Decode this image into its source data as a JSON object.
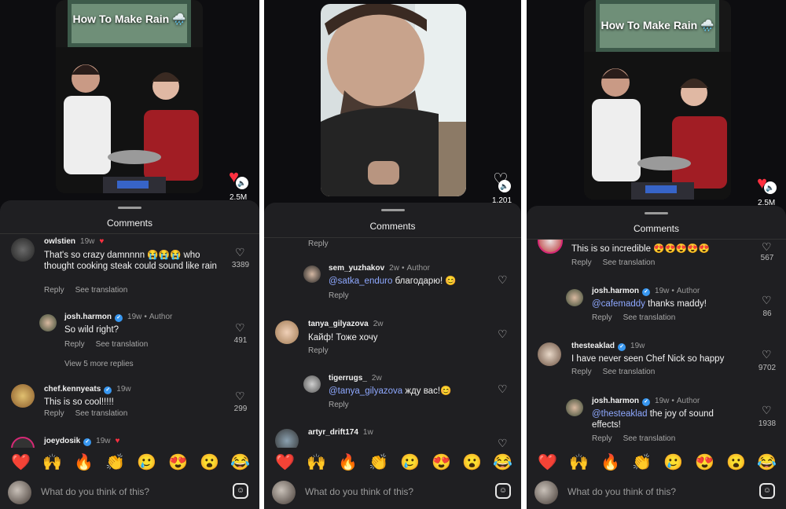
{
  "emojis": [
    "❤️",
    "🙌",
    "🔥",
    "👏",
    "🥲",
    "😍",
    "😮",
    "😂"
  ],
  "input_placeholder": "What do you think of this?",
  "sheet_title": "Comments",
  "reply_label": "Reply",
  "see_translation_label": "See translation",
  "panel1": {
    "video_title": "How To Make Rain 🌧️",
    "like_count": "2.5M",
    "comments": [
      {
        "username": "owlstien",
        "time": "19w",
        "text": "That's so crazy damnnnn 😭😭😭 who thought cooking steak could sound like rain",
        "likes": "3389"
      },
      {
        "username": "josh.harmon",
        "time": "19w",
        "author": "Author",
        "text": "So wild right?",
        "likes": "491"
      },
      {
        "username": "chef.kennyeats",
        "time": "19w",
        "text": "This is so cool!!!!!",
        "likes": "299"
      },
      {
        "username": "joeydosik",
        "time": "19w"
      }
    ],
    "view_more": "View 5 more replies"
  },
  "panel2": {
    "like_count": "1,201",
    "comments": [
      {
        "username": "sem_yuzhakov",
        "time": "2w",
        "author": "Author",
        "mention": "@satka_enduro",
        "text": " благодарю! 😊"
      },
      {
        "username": "tanya_gilyazova",
        "time": "2w",
        "text": "Кайф! Тоже хочу"
      },
      {
        "username": "tigerrugs_",
        "time": "2w",
        "mention": "@tanya_gilyazova",
        "text": " жду вас!😊"
      },
      {
        "username": "artyr_drift174",
        "time": "1w"
      }
    ]
  },
  "panel3": {
    "video_title": "How To Make Rain 🌧️",
    "like_count": "2.5M",
    "comments": [
      {
        "text": "This is so incredible 😍😍😍😍😍",
        "likes": "567"
      },
      {
        "username": "josh.harmon",
        "time": "19w",
        "author": "Author",
        "mention": "@cafemaddy",
        "text": " thanks maddy!",
        "likes": "86"
      },
      {
        "username": "thesteaklad",
        "time": "19w",
        "text": "I have never seen Chef Nick so happy",
        "likes": "9702"
      },
      {
        "username": "josh.harmon",
        "time": "19w",
        "author": "Author",
        "mention": "@thesteaklad",
        "text": " the joy of sound effects!",
        "likes": "1938"
      }
    ]
  }
}
